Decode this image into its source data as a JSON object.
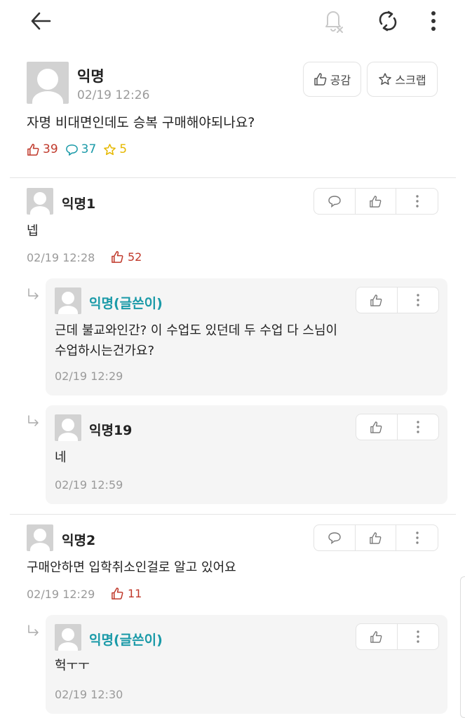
{
  "post": {
    "author": "익명",
    "time": "02/19 12:26",
    "text": "자명 비대면인데도 승복 구매해야되나요?",
    "like_button": "공감",
    "scrap_button": "스크랩",
    "likes": "39",
    "comments": "37",
    "scraps": "5"
  },
  "comments": [
    {
      "name": "익명1",
      "text": "넵",
      "time": "02/19 12:28",
      "likes": "52"
    },
    {
      "name": "익명(글쓴이)",
      "text_line1": "근데 불교와인간? 이 수업도 있던데 두 수업 다 스님이",
      "text_line2": "수업하시는건가요?",
      "time": "02/19 12:29"
    },
    {
      "name": "익명19",
      "text": "네",
      "time": "02/19 12:59"
    },
    {
      "name": "익명2",
      "text": "구매안하면 입학취소인걸로 알고 있어요",
      "time": "02/19 12:29",
      "likes": "11"
    },
    {
      "name": "익명(글쓴이)",
      "text": "헉ㅜㅜ",
      "time": "02/19 12:30"
    }
  ],
  "colors": {
    "like": "#c0392b",
    "comment": "#1a9aa8",
    "scrap": "#e6b800",
    "writer": "#1a9aa8"
  },
  "icons": [
    "back-arrow-icon",
    "notification-off-icon",
    "refresh-icon",
    "more-vertical-icon",
    "thumbs-up-icon",
    "star-icon",
    "comment-bubble-icon",
    "reply-arrow-icon"
  ]
}
